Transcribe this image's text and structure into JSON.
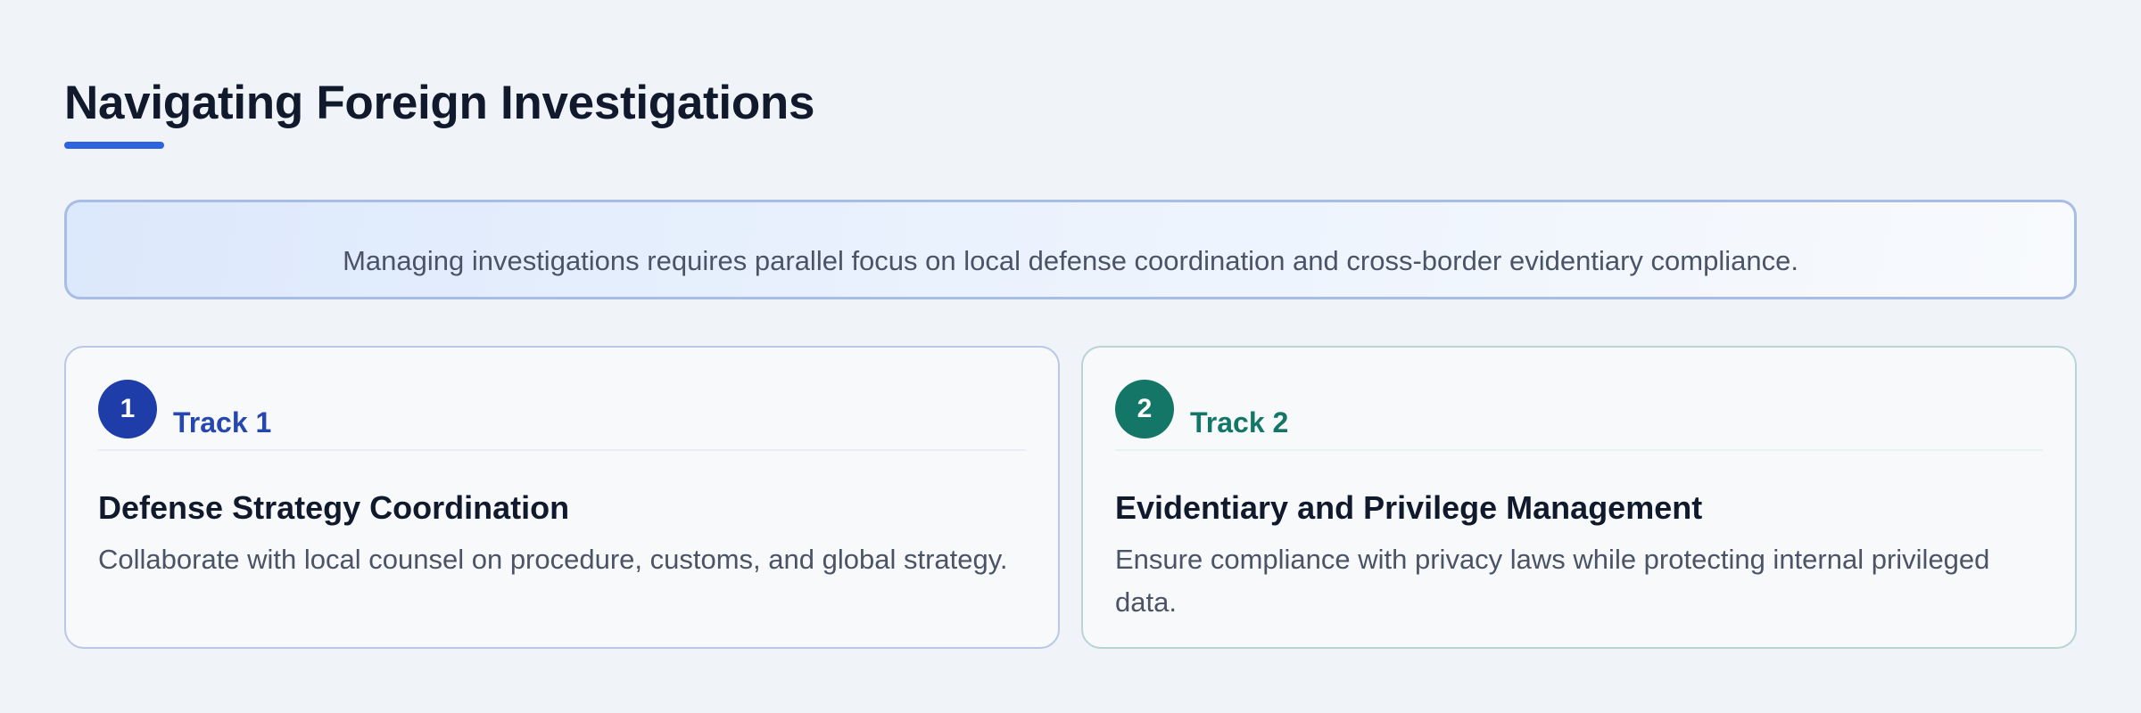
{
  "page": {
    "title": "Navigating Foreign Investigations",
    "summary": "Managing investigations requires parallel focus on local defense coordination and cross-border evidentiary compliance."
  },
  "tracks": [
    {
      "number": "1",
      "label": "Track 1",
      "title": "Defense Strategy Coordination",
      "description": "Collaborate with local counsel on procedure, customs, and global strategy.",
      "accent_color": "#1f3da8"
    },
    {
      "number": "2",
      "label": "Track 2",
      "title": "Evidentiary and Privilege Management",
      "description": "Ensure compliance with privacy laws while protecting internal privileged data.",
      "accent_color": "#137667"
    }
  ],
  "colors": {
    "accent": "#2d63de",
    "background": "#f0f3f8",
    "heading": "#111a2c",
    "body_text": "#4a5466"
  }
}
